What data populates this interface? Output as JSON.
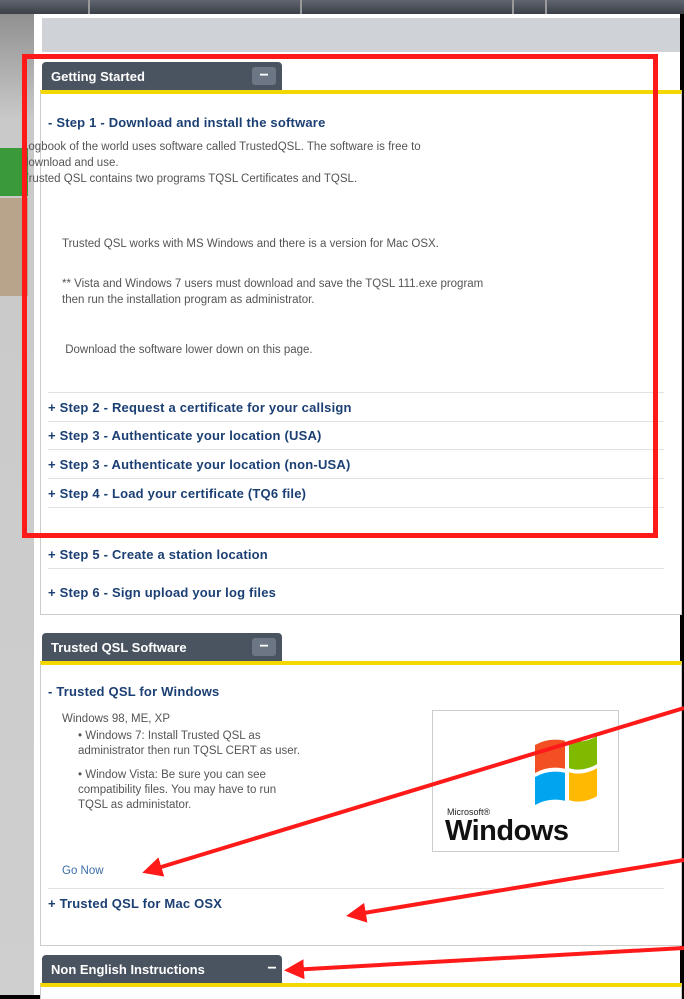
{
  "getting_started": {
    "tab_title": "Getting Started",
    "collapse_symbol": "−",
    "step1": {
      "title": "- Step 1 - Download and install the software",
      "p1_line1": "Logbook of the world uses software called TrustedQSL.  The software is free to",
      "p1_line2": "download and use.",
      "p1_line3": "Trusted QSL contains two programs TQSL Certificates and TQSL.",
      "p2": "Trusted QSL works with MS Windows and there is a version for Mac OSX.",
      "p3_line1": "** Vista and Windows 7 users must download and save the TQSL 111.exe program",
      "p3_line2": "then run the installation program as administrator.",
      "p4": " Download the software lower down on this page."
    },
    "steps": [
      "+ Step 2 - Request a certificate for your callsign",
      "+ Step 3 - Authenticate your location (USA)",
      "+ Step 3 - Authenticate your location (non-USA)",
      "+ Step 4 - Load your certificate (TQ6 file)",
      "+ Step 5 - Create a station location",
      "+ Step 6 - Sign upload your log files"
    ]
  },
  "tqsl_software": {
    "tab_title": "Trusted QSL Software",
    "collapse_symbol": "−",
    "windows_title": "- Trusted QSL for Windows",
    "os_line": "Windows 98, ME, XP",
    "bullet1_line1": "•  Windows 7: Install Trusted QSL as",
    "bullet1_line2": "administrator then run TQSL CERT as user.",
    "bullet2_line1": "•  Window Vista: Be sure you can see",
    "bullet2_line2": "compatibility files.  You may have to run",
    "bullet2_line3": "TQSL as administator.",
    "go_now": "Go Now",
    "mac_title": "+ Trusted QSL for Mac OSX",
    "logo_microsoft": "Microsoft®",
    "logo_windows": "Windows"
  },
  "non_english": {
    "tab_title": "Non English Instructions",
    "collapse_symbol": "−"
  },
  "colors": {
    "tab_bg": "#4a5460",
    "accent_yellow": "#f2d700",
    "link_blue": "#1b3f73",
    "highlight_red": "#ff1a1a"
  }
}
